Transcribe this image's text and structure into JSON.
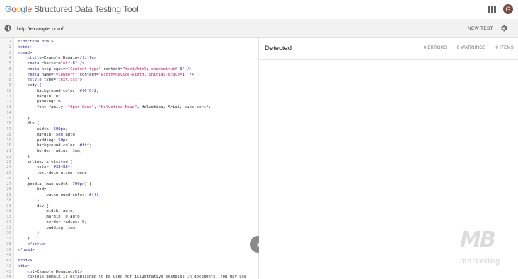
{
  "header": {
    "logo_letters": [
      {
        "char": "G",
        "color": "#4285F4"
      },
      {
        "char": "o",
        "color": "#EA4335"
      },
      {
        "char": "o",
        "color": "#FBBC05"
      },
      {
        "char": "g",
        "color": "#4285F4"
      },
      {
        "char": "l",
        "color": "#34A853"
      },
      {
        "char": "e",
        "color": "#EA4335"
      }
    ],
    "tool_name": "Structured Data Testing Tool",
    "apps_icon": "apps-grid-icon",
    "avatar_initial": "G",
    "avatar_color": "#7a4b40"
  },
  "url_bar": {
    "value": "http://example.com/",
    "globe_icon": "globe-icon",
    "new_test_label": "NEW TEST",
    "settings_icon": "gear-icon"
  },
  "editor": {
    "lines": [
      "<!doctype html>",
      "<html>",
      "<head>",
      "    <title>Example Domain</title>",
      "    <meta charset=\"utf-8\" />",
      "    <meta http-equiv=\"Content-type\" content=\"text/html; charset=utf-8\" />",
      "    <meta name=\"viewport\" content=\"width=device-width, initial-scale=1\" />",
      "    <style type=\"text/css\">",
      "    body {",
      "        background-color: #f0f0f2;",
      "        margin: 0;",
      "        padding: 0;",
      "        font-family: \"Open Sans\", \"Helvetica Neue\", Helvetica, Arial, sans-serif;",
      "",
      "    }",
      "    div {",
      "        width: 600px;",
      "        margin: 5em auto;",
      "        padding: 50px;",
      "        background-color: #fff;",
      "        border-radius: 1em;",
      "    }",
      "    a:link, a:visited {",
      "        color: #38488f;",
      "        text-decoration: none;",
      "    }",
      "    @media (max-width: 700px) {",
      "        body {",
      "            background-color: #fff;",
      "        }",
      "        div {",
      "            width: auto;",
      "            margin: 0 auto;",
      "            border-radius: 0;",
      "            padding: 1em;",
      "        }",
      "    }",
      "    </style>",
      "</head>",
      "",
      "<body>",
      "<div>",
      "    <h1>Example Domain</h1>",
      "    <p>This domain is established to be used for illustrative examples in documents. You may use"
    ],
    "run_icon": "play-icon"
  },
  "results": {
    "title": "Detected",
    "errors": "0 ERRORS",
    "warnings": "0 WARNINGS",
    "items": "0 ITEMS"
  },
  "watermark": {
    "mark": "MB",
    "text": "marketing"
  }
}
